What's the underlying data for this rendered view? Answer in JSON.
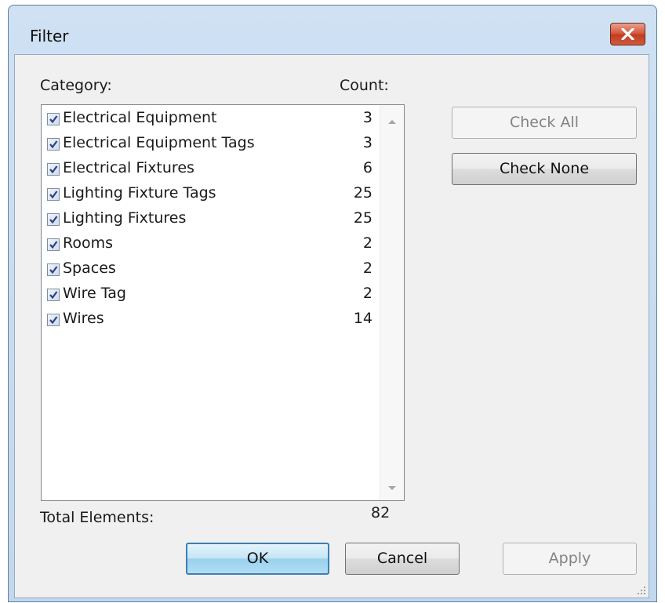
{
  "window": {
    "title": "Filter"
  },
  "headers": {
    "category": "Category:",
    "count": "Count:"
  },
  "categories": [
    {
      "label": "Electrical Equipment",
      "count": "3",
      "checked": true
    },
    {
      "label": "Electrical Equipment Tags",
      "count": "3",
      "checked": true
    },
    {
      "label": "Electrical Fixtures",
      "count": "6",
      "checked": true
    },
    {
      "label": "Lighting Fixture Tags",
      "count": "25",
      "checked": true
    },
    {
      "label": "Lighting Fixtures",
      "count": "25",
      "checked": true
    },
    {
      "label": "Rooms",
      "count": "2",
      "checked": true
    },
    {
      "label": "Spaces",
      "count": "2",
      "checked": true
    },
    {
      "label": "Wire Tag",
      "count": "2",
      "checked": true
    },
    {
      "label": "Wires",
      "count": "14",
      "checked": true
    }
  ],
  "side_buttons": {
    "check_all": "Check All",
    "check_none": "Check None"
  },
  "total": {
    "label": "Total Elements:",
    "value": "82"
  },
  "footer_buttons": {
    "ok": "OK",
    "cancel": "Cancel",
    "apply": "Apply"
  },
  "colors": {
    "checkmark": "#2f3d8a",
    "title_bar": "#c6dbf0",
    "close_button": "#c9482b"
  }
}
